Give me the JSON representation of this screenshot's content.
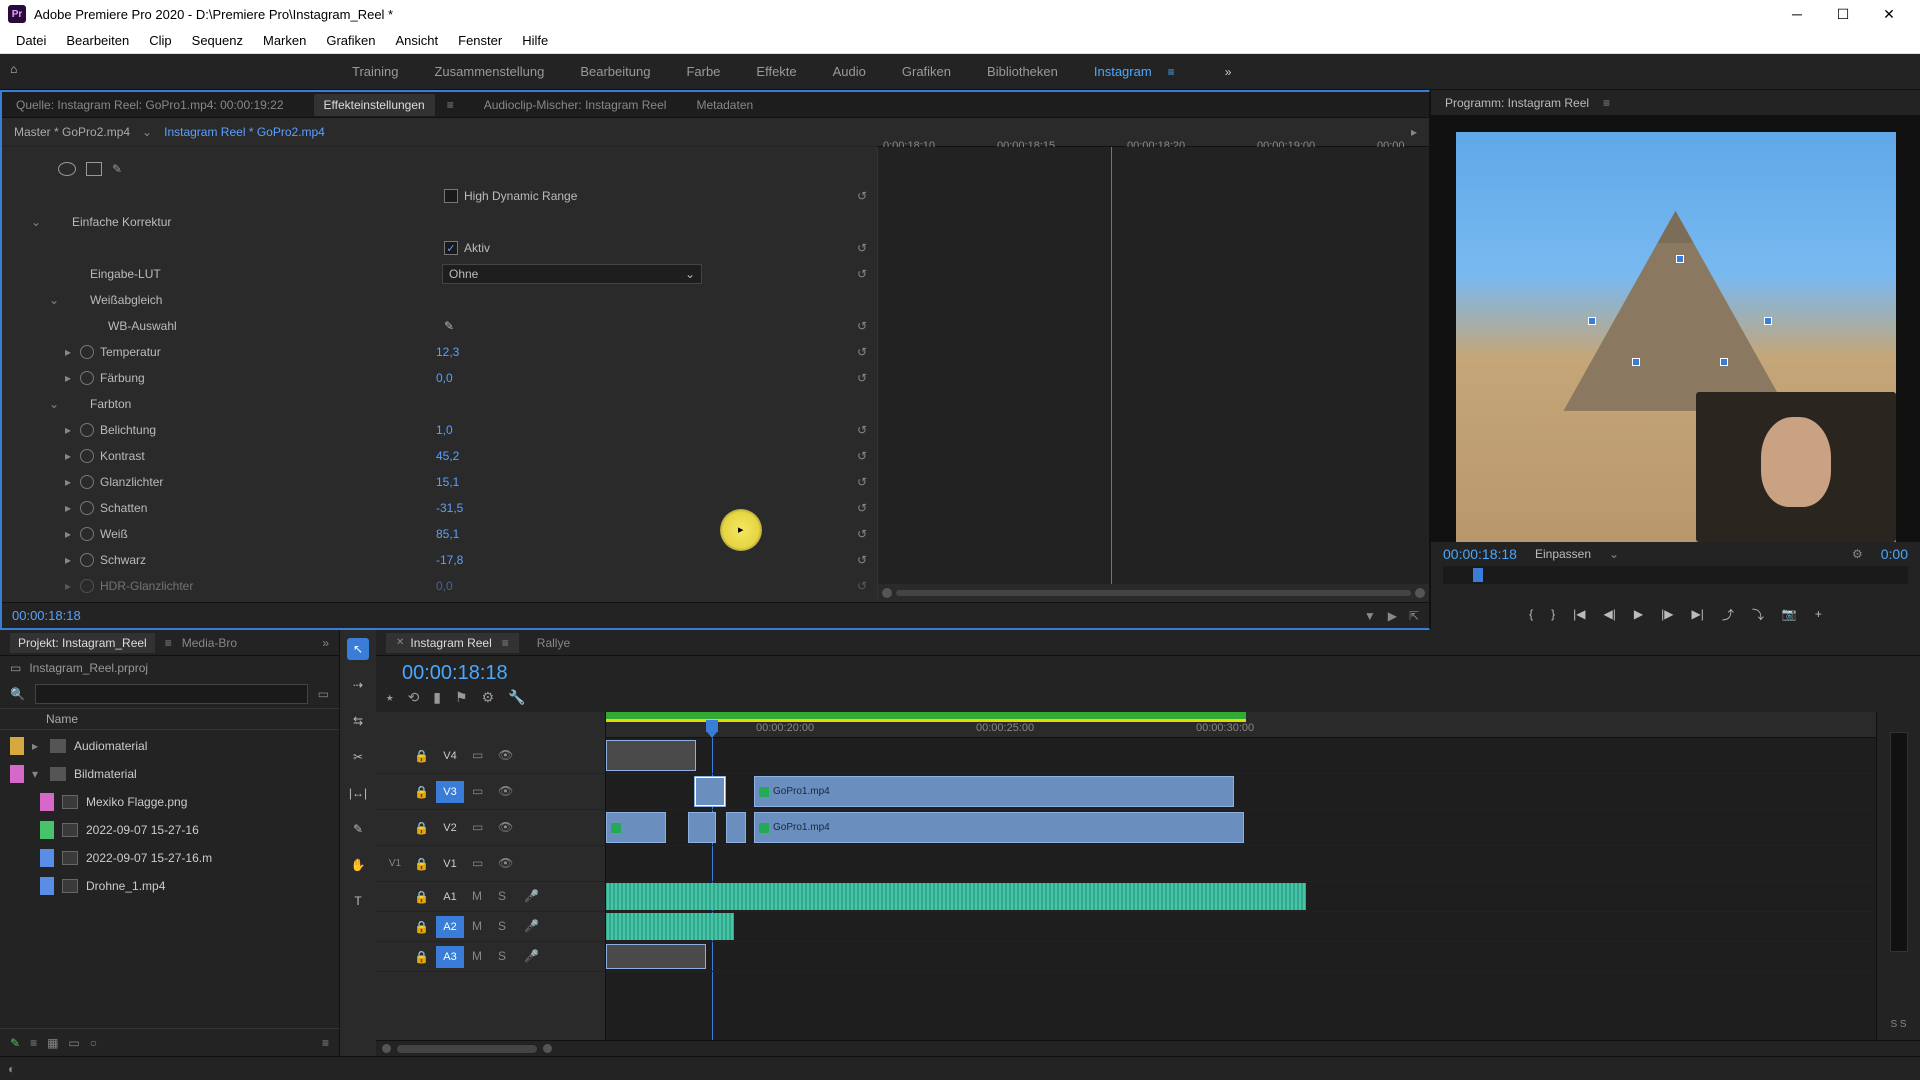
{
  "titlebar": {
    "app_icon": "Pr",
    "title": "Adobe Premiere Pro 2020 - D:\\Premiere Pro\\Instagram_Reel *"
  },
  "menu": [
    "Datei",
    "Bearbeiten",
    "Clip",
    "Sequenz",
    "Marken",
    "Grafiken",
    "Ansicht",
    "Fenster",
    "Hilfe"
  ],
  "workspaces": {
    "items": [
      "Training",
      "Zusammenstellung",
      "Bearbeitung",
      "Farbe",
      "Effekte",
      "Audio",
      "Grafiken",
      "Bibliotheken",
      "Instagram"
    ],
    "active": "Instagram"
  },
  "source_tabs": {
    "items": [
      "Quelle: Instagram Reel: GoPro1.mp4: 00:00:19:22",
      "Effekteinstellungen",
      "Audioclip-Mischer: Instagram Reel",
      "Metadaten"
    ],
    "active_index": 1
  },
  "effect_header": {
    "master": "Master * GoPro2.mp4",
    "clip": "Instagram Reel * GoPro2.mp4",
    "ruler_labels": [
      "0:00:18:10",
      "00:00:18:15",
      "00:00:18:20",
      "00:00:19:00",
      "00:00"
    ],
    "hdr_label": "High Dynamic Range"
  },
  "effect_props": {
    "section1": "Einfache Korrektur",
    "aktiv": "Aktiv",
    "lut_label": "Eingabe-LUT",
    "lut_value": "Ohne",
    "wb": "Weißabgleich",
    "wb_sel": "WB-Auswahl",
    "rows": [
      {
        "label": "Temperatur",
        "value": "12,3"
      },
      {
        "label": "Färbung",
        "value": "0,0"
      }
    ],
    "tone": "Farbton",
    "tone_rows": [
      {
        "label": "Belichtung",
        "value": "1,0"
      },
      {
        "label": "Kontrast",
        "value": "45,2"
      },
      {
        "label": "Glanzlichter",
        "value": "15,1"
      },
      {
        "label": "Schatten",
        "value": "-31,5"
      },
      {
        "label": "Weiß",
        "value": "85,1"
      },
      {
        "label": "Schwarz",
        "value": "-17,8"
      },
      {
        "label": "HDR-Glanzlichter",
        "value": "0,0"
      }
    ]
  },
  "effect_footer_tc": "00:00:18:18",
  "program": {
    "title": "Programm: Instagram Reel",
    "tc": "00:00:18:18",
    "fit": "Einpassen",
    "tc_right": "0:00"
  },
  "project": {
    "tab": "Projekt: Instagram_Reel",
    "tab2": "Media-Bro",
    "file": "Instagram_Reel.prproj",
    "col_name": "Name",
    "items": [
      {
        "type": "folder",
        "color": "#d6a840",
        "label": "Audiomaterial",
        "indent": 0,
        "exp": "▸"
      },
      {
        "type": "folder",
        "color": "#d668c8",
        "label": "Bildmaterial",
        "indent": 0,
        "exp": "▾"
      },
      {
        "type": "file",
        "color": "#d668c8",
        "label": "Mexiko Flagge.png",
        "indent": 1
      },
      {
        "type": "file",
        "color": "#47c46b",
        "label": "2022-09-07 15-27-16",
        "indent": 1
      },
      {
        "type": "file",
        "color": "#5a8de6",
        "label": "2022-09-07 15-27-16.m",
        "indent": 1
      },
      {
        "type": "file",
        "color": "#5a8de6",
        "label": "Drohne_1.mp4",
        "indent": 1
      }
    ]
  },
  "timeline": {
    "tab": "Instagram Reel",
    "tab2": "Rallye",
    "tc": "00:00:18:18",
    "ruler": [
      "00:00:20:00",
      "00:00:25:00",
      "00:00:30:00"
    ],
    "video_tracks": [
      "V4",
      "V3",
      "V2",
      "V1"
    ],
    "audio_tracks": [
      "A1",
      "A2",
      "A3"
    ],
    "v1_label": "V1",
    "clip1": "GoPro1.mp4",
    "clip2": "GoPro1.mp4",
    "ss": "S  S"
  }
}
